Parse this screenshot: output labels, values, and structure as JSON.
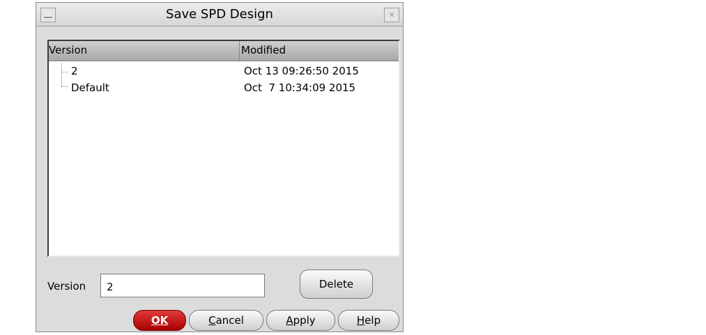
{
  "window": {
    "title": "Save SPD Design",
    "minimize_glyph": "",
    "close_glyph": "✕"
  },
  "list": {
    "columns": [
      "Version",
      "Modified"
    ],
    "rows": [
      {
        "version": "2",
        "modified": "Oct 13 09:26:50 2015"
      },
      {
        "version": "Default",
        "modified": "Oct  7 10:34:09 2015"
      }
    ]
  },
  "version_field": {
    "label": "Version",
    "value": "2"
  },
  "buttons": {
    "delete": "Delete",
    "ok": "OK",
    "cancel": "Cancel",
    "apply": "Apply",
    "help": "Help"
  }
}
